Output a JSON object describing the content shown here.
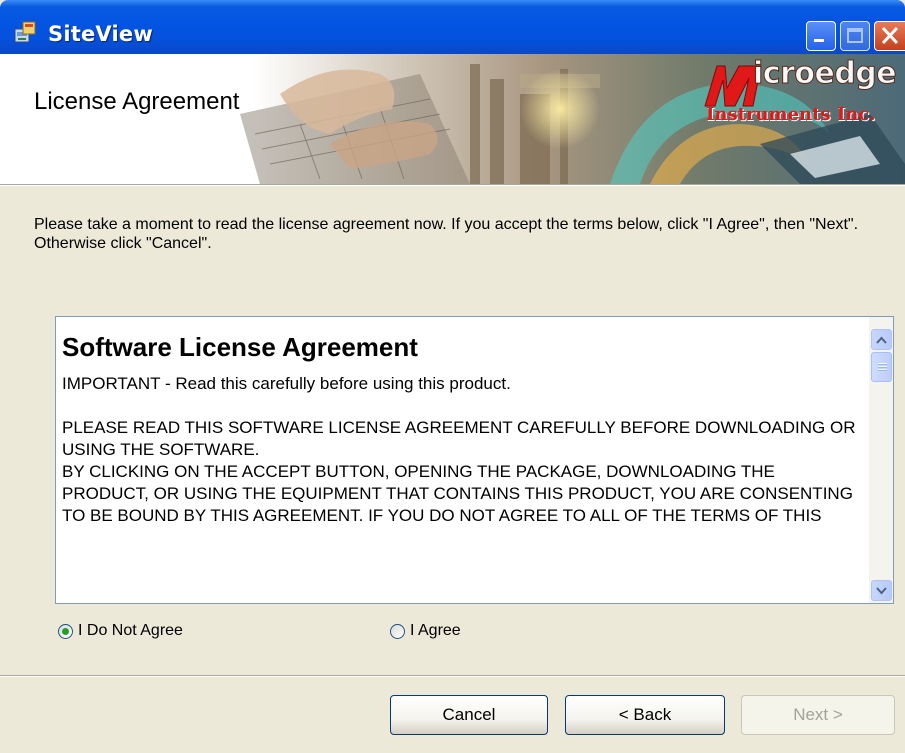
{
  "window": {
    "title": "SiteView",
    "controls": [
      "minimize-icon",
      "maximize-icon",
      "close-icon"
    ]
  },
  "banner": {
    "title": "License Agreement",
    "logo_wordmark": "icroedge",
    "logo_subtitle": "Instruments Inc."
  },
  "intro_text": "Please take a moment to read the license agreement now. If you accept the terms below, click \"I Agree\", then \"Next\". Otherwise click \"Cancel\".",
  "license": {
    "heading": "Software License Agreement",
    "important": "IMPORTANT - Read this carefully before using this product.",
    "paragraph": "PLEASE READ THIS SOFTWARE LICENSE AGREEMENT CAREFULLY BEFORE DOWNLOADING OR USING THE SOFTWARE.\nBY CLICKING ON THE ACCEPT BUTTON, OPENING THE PACKAGE, DOWNLOADING THE PRODUCT, OR USING THE EQUIPMENT THAT CONTAINS THIS PRODUCT, YOU ARE CONSENTING TO BE BOUND BY THIS AGREEMENT. IF YOU DO NOT AGREE TO ALL OF THE TERMS OF THIS"
  },
  "options": {
    "disagree": "I Do Not Agree",
    "agree": "I Agree",
    "selected": "disagree"
  },
  "buttons": {
    "cancel": "Cancel",
    "back": "< Back",
    "next": "Next >",
    "next_enabled": false
  },
  "colors": {
    "titlebar": "#0454e3",
    "window_bg": "#ece9d8",
    "logo_red": "#e01818",
    "radio_selected": "#21a121"
  }
}
